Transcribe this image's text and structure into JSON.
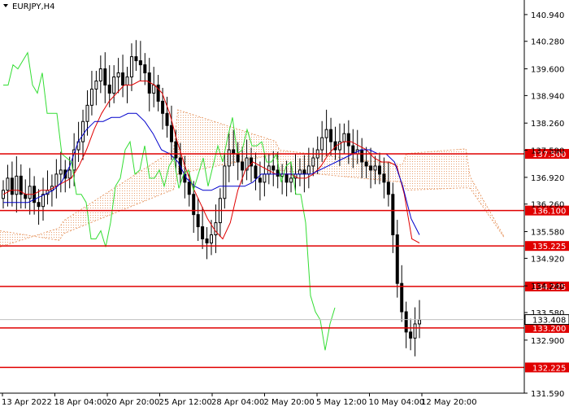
{
  "header": {
    "symbol": "EURJPY,H4",
    "menu_icon": "triangle-down-icon"
  },
  "colors": {
    "background": "#ffffff",
    "candle": "#000000",
    "tenkan": "#e00000",
    "kijun": "#0000cc",
    "chikou": "#33dd33",
    "cloud_bull": "#e8a070",
    "cloud_bear": "#b0a0d8",
    "level_line": "#e00000",
    "level_label_bg": "#e00000",
    "current_price_line": "#c0c0c0"
  },
  "chart_data": {
    "type": "candlestick",
    "title": "EURJPY,H4",
    "ylim": [
      131.59,
      141.3
    ],
    "y_ticks": [
      "140.940",
      "140.280",
      "139.600",
      "138.940",
      "138.260",
      "137.590",
      "136.920",
      "136.260",
      "135.580",
      "134.920",
      "134.240",
      "133.580",
      "132.900",
      "131.590"
    ],
    "x_ticks": [
      "13 Apr 2022",
      "18 Apr 04:00",
      "20 Apr 20:00",
      "25 Apr 12:00",
      "28 Apr 04:00",
      "2 May 20:00",
      "5 May 12:00",
      "10 May 04:00",
      "12 May 20:00"
    ],
    "levels": [
      {
        "value": 137.5,
        "label": "137.500"
      },
      {
        "value": 136.1,
        "label": "136.100"
      },
      {
        "value": 135.225,
        "label": "135.225"
      },
      {
        "value": 134.225,
        "label": "134.225"
      },
      {
        "value": 133.2,
        "label": "133.200"
      },
      {
        "value": 132.225,
        "label": "132.225"
      }
    ],
    "current_price": {
      "value": 133.408,
      "label": "133.408"
    },
    "candles_close": [
      136.6,
      136.9,
      136.5,
      136.95,
      136.5,
      136.4,
      136.7,
      136.3,
      136.2,
      136.5,
      136.6,
      136.7,
      137.0,
      137.1,
      136.9,
      137.1,
      137.6,
      137.8,
      138.3,
      138.7,
      139.1,
      139.3,
      139.6,
      139.2,
      139.0,
      139.4,
      139.5,
      139.2,
      139.4,
      139.9,
      139.8,
      139.7,
      139.5,
      139.0,
      139.2,
      138.8,
      138.5,
      138.2,
      137.8,
      137.4,
      137.0,
      136.8,
      136.5,
      136.0,
      135.7,
      135.4,
      135.3,
      135.5,
      135.8,
      136.4,
      137.2,
      137.6,
      137.5,
      137.3,
      137.1,
      137.4,
      137.2,
      136.9,
      136.8,
      137.0,
      137.2,
      137.1,
      136.95,
      137.0,
      136.8,
      136.9,
      137.0,
      137.1,
      137.0,
      137.2,
      137.4,
      137.6,
      137.9,
      138.1,
      137.8,
      137.6,
      137.8,
      138.0,
      137.7,
      137.5,
      137.6,
      137.3,
      137.2,
      137.1,
      137.2,
      137.0,
      136.8,
      136.5,
      135.5,
      134.3,
      133.6,
      133.1,
      132.95,
      133.3,
      133.4
    ],
    "tenkan": [
      136.5,
      136.6,
      136.6,
      136.5,
      136.5,
      136.6,
      136.6,
      136.7,
      136.8,
      136.9,
      137.2,
      137.6,
      138.1,
      138.5,
      138.8,
      139.0,
      139.2,
      139.2,
      139.3,
      139.3,
      139.2,
      139.0,
      138.5,
      137.8,
      137.2,
      136.7,
      136.3,
      135.9,
      135.6,
      135.4,
      135.8,
      136.6,
      137.1,
      137.3,
      137.2,
      137.1,
      137.0,
      137.0,
      137.0,
      136.9,
      136.9,
      137.0,
      137.2,
      137.5,
      137.7,
      137.8,
      137.8,
      137.7,
      137.6,
      137.4,
      137.3,
      137.3,
      137.2,
      136.5,
      135.4,
      135.3
    ],
    "kijun": [
      136.3,
      136.3,
      136.3,
      136.3,
      136.4,
      136.5,
      136.6,
      136.8,
      137.2,
      137.8,
      138.1,
      138.3,
      138.3,
      138.4,
      138.4,
      138.5,
      138.5,
      138.3,
      138.0,
      137.6,
      137.5,
      137.3,
      136.9,
      136.7,
      136.6,
      136.6,
      136.7,
      136.7,
      136.7,
      136.7,
      136.8,
      137.0,
      137.0,
      137.0,
      137.0,
      137.0,
      137.0,
      137.0,
      137.1,
      137.2,
      137.3,
      137.4,
      137.5,
      137.6,
      137.6,
      137.5,
      137.5,
      137.3,
      136.7,
      135.9,
      135.5
    ]
  }
}
